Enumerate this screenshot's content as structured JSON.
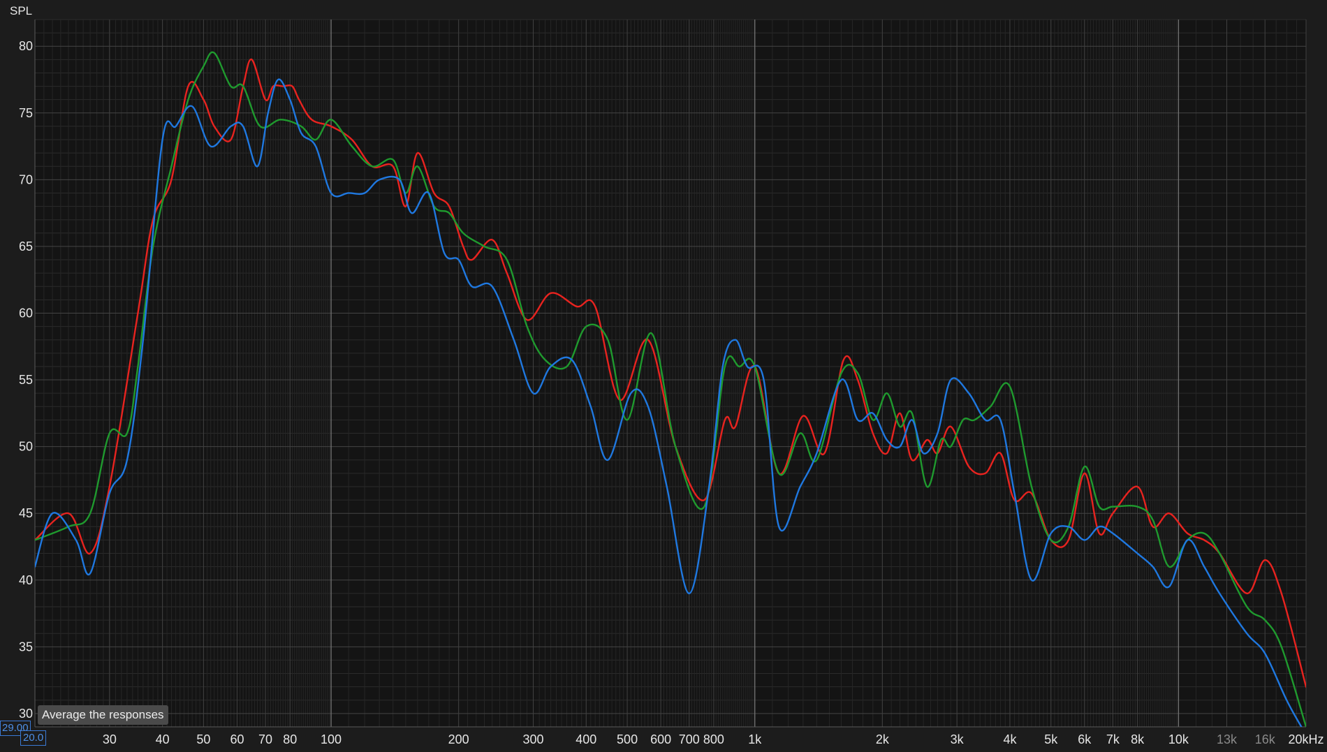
{
  "chart_data": {
    "type": "line",
    "ylabel": "SPL",
    "xlabel": "",
    "x_unit": "Hz",
    "x_scale": "log",
    "xlim": [
      20,
      20000
    ],
    "ylim": [
      29,
      82
    ],
    "y_ticks": [
      30,
      35,
      40,
      45,
      50,
      55,
      60,
      65,
      70,
      75,
      80
    ],
    "x_ticks": [
      {
        "value": 30,
        "label": "30"
      },
      {
        "value": 40,
        "label": "40"
      },
      {
        "value": 50,
        "label": "50"
      },
      {
        "value": 60,
        "label": "60"
      },
      {
        "value": 70,
        "label": "70"
      },
      {
        "value": 80,
        "label": "80"
      },
      {
        "value": 100,
        "label": "100"
      },
      {
        "value": 200,
        "label": "200"
      },
      {
        "value": 300,
        "label": "300"
      },
      {
        "value": 400,
        "label": "400"
      },
      {
        "value": 500,
        "label": "500"
      },
      {
        "value": 600,
        "label": "600"
      },
      {
        "value": 700,
        "label": "700"
      },
      {
        "value": 800,
        "label": "800"
      },
      {
        "value": 1000,
        "label": "1k"
      },
      {
        "value": 2000,
        "label": "2k"
      },
      {
        "value": 3000,
        "label": "3k"
      },
      {
        "value": 4000,
        "label": "4k"
      },
      {
        "value": 5000,
        "label": "5k"
      },
      {
        "value": 6000,
        "label": "6k"
      },
      {
        "value": 7000,
        "label": "7k"
      },
      {
        "value": 8000,
        "label": "8k"
      },
      {
        "value": 10000,
        "label": "10k"
      },
      {
        "value": 13000,
        "label": "13k",
        "dim": true
      },
      {
        "value": 16000,
        "label": "16k",
        "dim": true
      },
      {
        "value": 20000,
        "label": "20kHz"
      }
    ],
    "grid": true,
    "legend": "none",
    "series": [
      {
        "color": "#e8231f",
        "points": [
          [
            20,
            43
          ],
          [
            24,
            45
          ],
          [
            27,
            42
          ],
          [
            30,
            47
          ],
          [
            35,
            60
          ],
          [
            38,
            67
          ],
          [
            42,
            70
          ],
          [
            46,
            77
          ],
          [
            50,
            76
          ],
          [
            53,
            74
          ],
          [
            58,
            73
          ],
          [
            62,
            77
          ],
          [
            65,
            79
          ],
          [
            70,
            76
          ],
          [
            73,
            77
          ],
          [
            77,
            77
          ],
          [
            81,
            77
          ],
          [
            84,
            76
          ],
          [
            90,
            74.5
          ],
          [
            100,
            74
          ],
          [
            112,
            73
          ],
          [
            125,
            71
          ],
          [
            140,
            71
          ],
          [
            150,
            68
          ],
          [
            160,
            72
          ],
          [
            175,
            69
          ],
          [
            190,
            68
          ],
          [
            205,
            65
          ],
          [
            215,
            64
          ],
          [
            240,
            65.5
          ],
          [
            260,
            63
          ],
          [
            290,
            59.5
          ],
          [
            330,
            61.5
          ],
          [
            380,
            60.5
          ],
          [
            420,
            60.5
          ],
          [
            480,
            53.5
          ],
          [
            560,
            58
          ],
          [
            650,
            50
          ],
          [
            760,
            46
          ],
          [
            850,
            52
          ],
          [
            900,
            51.5
          ],
          [
            1000,
            56
          ],
          [
            1140,
            48
          ],
          [
            1300,
            52.3
          ],
          [
            1460,
            49.5
          ],
          [
            1620,
            56.5
          ],
          [
            1750,
            55
          ],
          [
            1900,
            51
          ],
          [
            2050,
            49.5
          ],
          [
            2200,
            52.5
          ],
          [
            2350,
            49
          ],
          [
            2550,
            50.5
          ],
          [
            2700,
            49.5
          ],
          [
            2900,
            51.5
          ],
          [
            3200,
            48.5
          ],
          [
            3500,
            48
          ],
          [
            3800,
            49.5
          ],
          [
            4100,
            46
          ],
          [
            4500,
            46.5
          ],
          [
            5000,
            43
          ],
          [
            5500,
            43
          ],
          [
            6000,
            48
          ],
          [
            6500,
            43.5
          ],
          [
            7000,
            45
          ],
          [
            8000,
            47
          ],
          [
            8700,
            44
          ],
          [
            9500,
            45
          ],
          [
            10500,
            43.5
          ],
          [
            11500,
            43
          ],
          [
            12500,
            42
          ],
          [
            14500,
            39
          ],
          [
            16000,
            41.5
          ],
          [
            17500,
            39
          ],
          [
            20000,
            32
          ]
        ]
      },
      {
        "color": "#1f9a2e",
        "points": [
          [
            20,
            43
          ],
          [
            24,
            44
          ],
          [
            27,
            45
          ],
          [
            30,
            51
          ],
          [
            33,
            51
          ],
          [
            35,
            56
          ],
          [
            38,
            65
          ],
          [
            42,
            71
          ],
          [
            46,
            76
          ],
          [
            50,
            78.5
          ],
          [
            53,
            79.5
          ],
          [
            58,
            77
          ],
          [
            62,
            77
          ],
          [
            68,
            74
          ],
          [
            76,
            74.5
          ],
          [
            85,
            74
          ],
          [
            92,
            73
          ],
          [
            100,
            74.5
          ],
          [
            112,
            72.5
          ],
          [
            125,
            71
          ],
          [
            140,
            71.5
          ],
          [
            150,
            69
          ],
          [
            160,
            71
          ],
          [
            175,
            68
          ],
          [
            190,
            67.5
          ],
          [
            205,
            66
          ],
          [
            230,
            65
          ],
          [
            260,
            64
          ],
          [
            290,
            59
          ],
          [
            320,
            56.5
          ],
          [
            360,
            56
          ],
          [
            400,
            59
          ],
          [
            450,
            58
          ],
          [
            500,
            52
          ],
          [
            570,
            58.5
          ],
          [
            650,
            50
          ],
          [
            760,
            45.5
          ],
          [
            850,
            56
          ],
          [
            920,
            56
          ],
          [
            1000,
            56
          ],
          [
            1140,
            48
          ],
          [
            1280,
            51
          ],
          [
            1400,
            49
          ],
          [
            1600,
            55.5
          ],
          [
            1750,
            55.5
          ],
          [
            1900,
            52
          ],
          [
            2050,
            54
          ],
          [
            2200,
            51.5
          ],
          [
            2350,
            52.5
          ],
          [
            2550,
            47
          ],
          [
            2750,
            50.5
          ],
          [
            2900,
            50
          ],
          [
            3100,
            52
          ],
          [
            3300,
            52
          ],
          [
            3600,
            53
          ],
          [
            4000,
            54.5
          ],
          [
            4500,
            47
          ],
          [
            5000,
            43
          ],
          [
            5500,
            44
          ],
          [
            6000,
            48.5
          ],
          [
            6500,
            45.5
          ],
          [
            7000,
            45.5
          ],
          [
            8000,
            45.5
          ],
          [
            8700,
            44.5
          ],
          [
            9500,
            41
          ],
          [
            10500,
            43
          ],
          [
            11500,
            43.5
          ],
          [
            12500,
            42
          ],
          [
            14500,
            38
          ],
          [
            16000,
            37
          ],
          [
            17500,
            35
          ],
          [
            20000,
            29
          ]
        ]
      },
      {
        "color": "#1f78e0",
        "points": [
          [
            20,
            41
          ],
          [
            22,
            45
          ],
          [
            25,
            43
          ],
          [
            27,
            40.5
          ],
          [
            30,
            46.5
          ],
          [
            33,
            49
          ],
          [
            36,
            58
          ],
          [
            40,
            73
          ],
          [
            43,
            74
          ],
          [
            47,
            75.5
          ],
          [
            52,
            72.5
          ],
          [
            58,
            74
          ],
          [
            62,
            74
          ],
          [
            67,
            71
          ],
          [
            71,
            75
          ],
          [
            75,
            77.5
          ],
          [
            80,
            76
          ],
          [
            85,
            73.5
          ],
          [
            92,
            72.5
          ],
          [
            100,
            69
          ],
          [
            110,
            69
          ],
          [
            120,
            69
          ],
          [
            130,
            70
          ],
          [
            145,
            70
          ],
          [
            155,
            67.5
          ],
          [
            170,
            69
          ],
          [
            185,
            64.5
          ],
          [
            200,
            64
          ],
          [
            215,
            62
          ],
          [
            240,
            62
          ],
          [
            270,
            58
          ],
          [
            300,
            54
          ],
          [
            330,
            56
          ],
          [
            370,
            56.5
          ],
          [
            410,
            53
          ],
          [
            450,
            49
          ],
          [
            510,
            54
          ],
          [
            560,
            53
          ],
          [
            620,
            47
          ],
          [
            700,
            39
          ],
          [
            780,
            47
          ],
          [
            840,
            56
          ],
          [
            900,
            58
          ],
          [
            960,
            56
          ],
          [
            1050,
            55
          ],
          [
            1140,
            44
          ],
          [
            1280,
            47
          ],
          [
            1400,
            49.5
          ],
          [
            1600,
            55
          ],
          [
            1750,
            52
          ],
          [
            1900,
            52.5
          ],
          [
            2050,
            50.5
          ],
          [
            2200,
            50
          ],
          [
            2350,
            52
          ],
          [
            2500,
            49.5
          ],
          [
            2700,
            51
          ],
          [
            2900,
            55
          ],
          [
            3200,
            54
          ],
          [
            3500,
            52
          ],
          [
            3800,
            52
          ],
          [
            4100,
            46.5
          ],
          [
            4500,
            40
          ],
          [
            5000,
            43.5
          ],
          [
            5500,
            44
          ],
          [
            6000,
            43
          ],
          [
            6500,
            44
          ],
          [
            7000,
            43.5
          ],
          [
            8000,
            42
          ],
          [
            8700,
            41
          ],
          [
            9500,
            39.5
          ],
          [
            10500,
            43
          ],
          [
            11500,
            41
          ],
          [
            12500,
            39
          ],
          [
            14500,
            36
          ],
          [
            16000,
            34.5
          ],
          [
            18000,
            31
          ],
          [
            19500,
            29
          ]
        ]
      }
    ]
  },
  "overlay": {
    "tooltip_text": "Average the responses",
    "y_input_value": "29.00",
    "x_input_value": "20.0"
  }
}
